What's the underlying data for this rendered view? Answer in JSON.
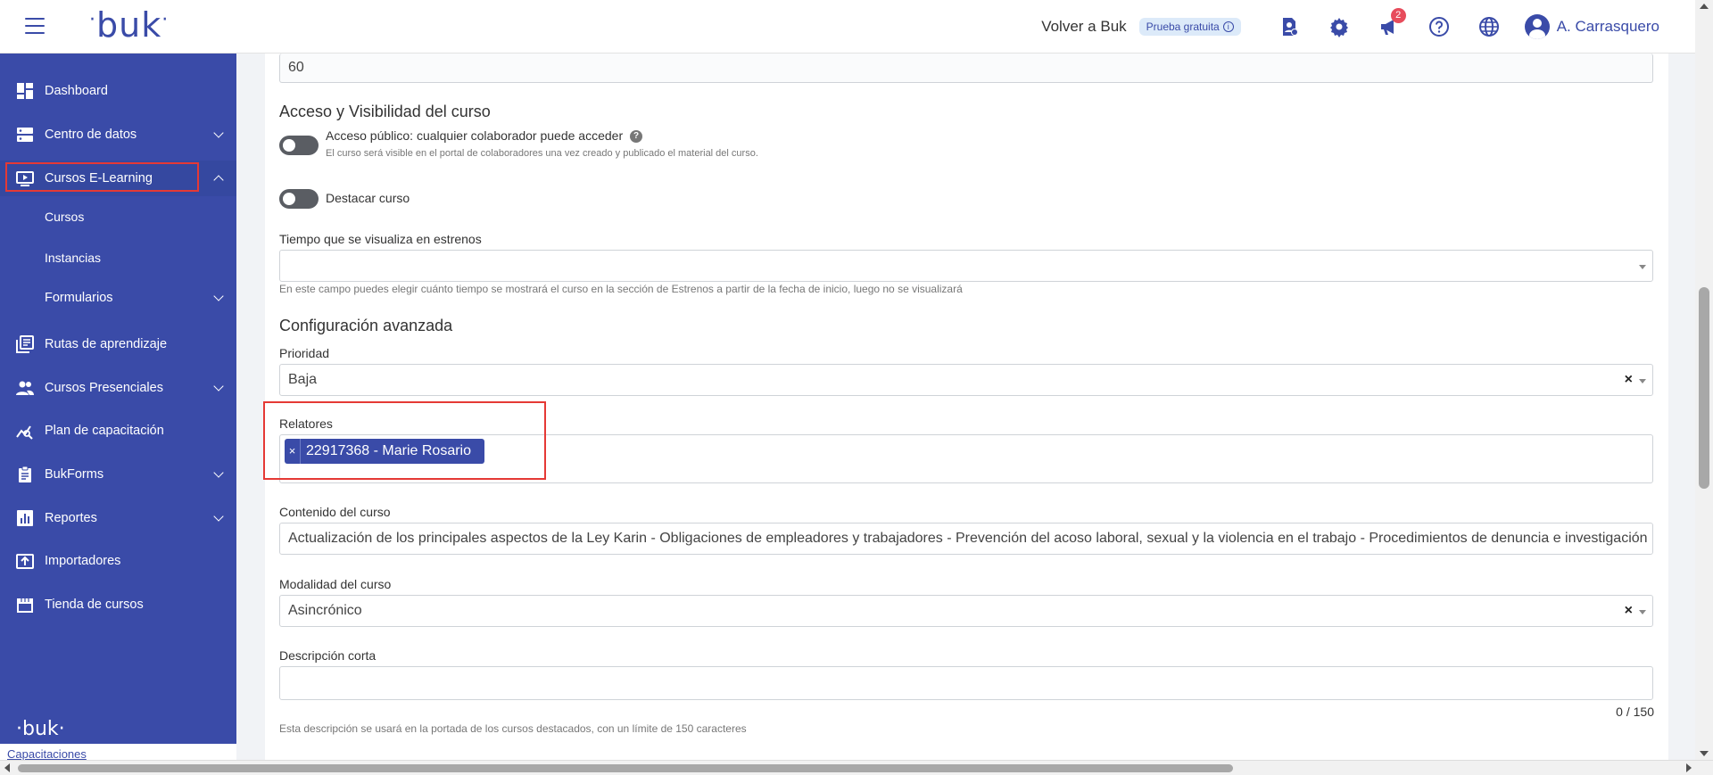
{
  "header": {
    "logo": "buk",
    "back_link": "Volver a Buk",
    "trial_badge": "Prueba gratuita",
    "notifications_count": "2",
    "user_name": "A. Carrasquero",
    "icons": [
      "menu-icon",
      "person-pin-icon",
      "gear-icon",
      "megaphone-icon",
      "help-icon",
      "globe-icon",
      "user-avatar-icon"
    ]
  },
  "sidebar": {
    "items": [
      {
        "label": "Dashboard",
        "icon": "dashboard-icon"
      },
      {
        "label": "Centro de datos",
        "icon": "server-icon"
      },
      {
        "label": "Cursos E-Learning",
        "icon": "video-screen-icon"
      },
      {
        "label": "Rutas de aprendizaje",
        "icon": "library-icon"
      },
      {
        "label": "Cursos Presenciales",
        "icon": "people-icon"
      },
      {
        "label": "Plan de capacitación",
        "icon": "chart-search-icon"
      },
      {
        "label": "BukForms",
        "icon": "clipboard-icon"
      },
      {
        "label": "Reportes",
        "icon": "bar-chart-icon"
      },
      {
        "label": "Importadores",
        "icon": "upload-icon"
      },
      {
        "label": "Tienda de cursos",
        "icon": "store-icon"
      }
    ],
    "sub_items": [
      "Cursos",
      "Instancias",
      "Formularios"
    ],
    "footer_logo": "buk",
    "footer_link": "Capacitaciones"
  },
  "form": {
    "top_value": "60",
    "access_title": "Acceso y Visibilidad del curso",
    "public_access_label": "Acceso público: cualquier colaborador puede acceder",
    "public_access_help": "El curso será visible en el portal de colaboradores una vez creado y publicado el material del curso.",
    "featured_label": "Destacar curso",
    "premiere_label": "Tiempo que se visualiza en estrenos",
    "premiere_value": "",
    "premiere_help": "En este campo puedes elegir cuánto tiempo se mostrará el curso en la sección de Estrenos a partir de la fecha de inicio, luego no se visualizará",
    "advanced_title": "Configuración avanzada",
    "priority_label": "Prioridad",
    "priority_value": "Baja",
    "speakers_label": "Relatores",
    "speaker_tag": "22917368 - Marie Rosario",
    "content_label": "Contenido del curso",
    "content_value": "Actualización de los principales aspectos de la Ley Karin - Obligaciones de empleadores y trabajadores - Prevención del acoso laboral, sexual y la violencia en el trabajo - Procedimientos de denuncia e investigación",
    "modality_label": "Modalidad del curso",
    "modality_value": "Asincrónico",
    "short_desc_label": "Descripción corta",
    "short_desc_value": "",
    "short_desc_counter": "0 / 150",
    "short_desc_help": "Esta descripción se usará en la portada de los cursos destacados, con un límite de 150 caracteres"
  },
  "colors": {
    "brand": "#3a4ba8",
    "highlight": "#e53935",
    "badge": "#e74c5c"
  }
}
